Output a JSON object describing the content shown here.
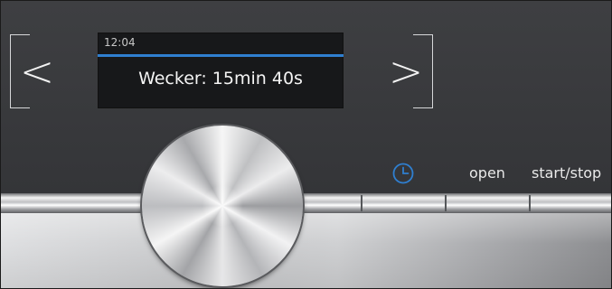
{
  "display": {
    "time": "12:04",
    "message": "Wecker: 15min 40s",
    "accent_color": "#2f7fd0"
  },
  "navigation": {
    "prev_glyph": "<",
    "next_glyph": ">"
  },
  "controls": {
    "timer_icon": "clock-icon",
    "open_label": "open",
    "start_stop_label": "start/stop"
  },
  "knob": {
    "icon": "rotary-selector-knob"
  }
}
